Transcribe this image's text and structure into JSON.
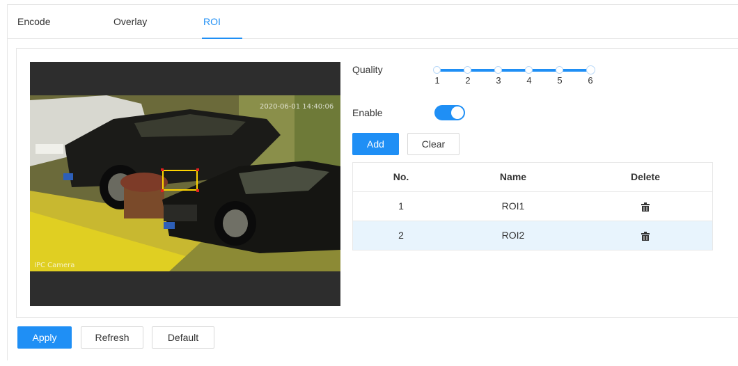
{
  "tabs": [
    {
      "label": "Encode",
      "active": false
    },
    {
      "label": "Overlay",
      "active": false
    },
    {
      "label": "ROI",
      "active": true
    }
  ],
  "video": {
    "osd_time": "2020-06-01 14:40:06",
    "osd_channel": "IPC Camera"
  },
  "quality": {
    "label": "Quality",
    "levels": [
      "1",
      "2",
      "3",
      "4",
      "5",
      "6"
    ],
    "value": 6
  },
  "enable": {
    "label": "Enable",
    "on": true
  },
  "roi_buttons": {
    "add": "Add",
    "clear": "Clear"
  },
  "table": {
    "headers": {
      "no": "No.",
      "name": "Name",
      "delete": "Delete"
    },
    "rows": [
      {
        "no": "1",
        "name": "ROI1",
        "selected": false
      },
      {
        "no": "2",
        "name": "ROI2",
        "selected": true
      }
    ]
  },
  "footer": {
    "apply": "Apply",
    "refresh": "Refresh",
    "default": "Default"
  },
  "colors": {
    "accent": "#1f8ff5",
    "roi_box": "#ffd500",
    "roi_handle": "#e02020",
    "selected_row": "#e8f4fd"
  },
  "icons": {
    "delete": "trash-icon"
  }
}
